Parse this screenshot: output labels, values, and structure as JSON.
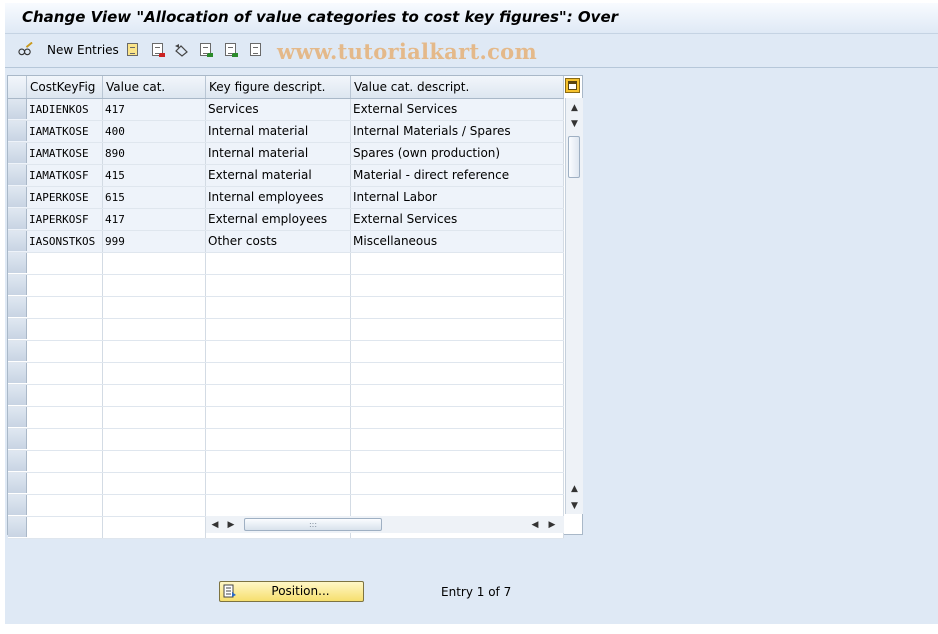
{
  "window": {
    "title": "Change View \"Allocation of value categories to cost key figures\": Over"
  },
  "toolbar": {
    "new_entries_label": "New Entries",
    "icons": [
      "glasses-pencil-icon",
      "copy-icon",
      "delete-icon",
      "undo-icon",
      "select-all-icon",
      "select-block-icon",
      "deselect-all-icon"
    ]
  },
  "watermark": {
    "text": "www.tutorialkart.com"
  },
  "table": {
    "columns": [
      "CostKeyFig",
      "Value cat.",
      "Key figure descript.",
      "Value cat. descript."
    ],
    "rows": [
      [
        "IADIENKOS",
        "417",
        "Services",
        "External Services"
      ],
      [
        "IAMATKOSE",
        "400",
        "Internal material",
        "Internal Materials / Spares"
      ],
      [
        "IAMATKOSE",
        "890",
        "Internal material",
        "Spares (own production)"
      ],
      [
        "IAMATKOSF",
        "415",
        "External material",
        "Material - direct reference"
      ],
      [
        "IAPERKOSE",
        "615",
        "Internal employees",
        "Internal Labor"
      ],
      [
        "IAPERKOSF",
        "417",
        "External employees",
        "External Services"
      ],
      [
        "IASONSTKOS",
        "999",
        "Other costs",
        "Miscellaneous"
      ]
    ],
    "empty_rows": 13
  },
  "footer": {
    "position_button_label": "Position...",
    "entry_info": "Entry 1 of 7"
  }
}
